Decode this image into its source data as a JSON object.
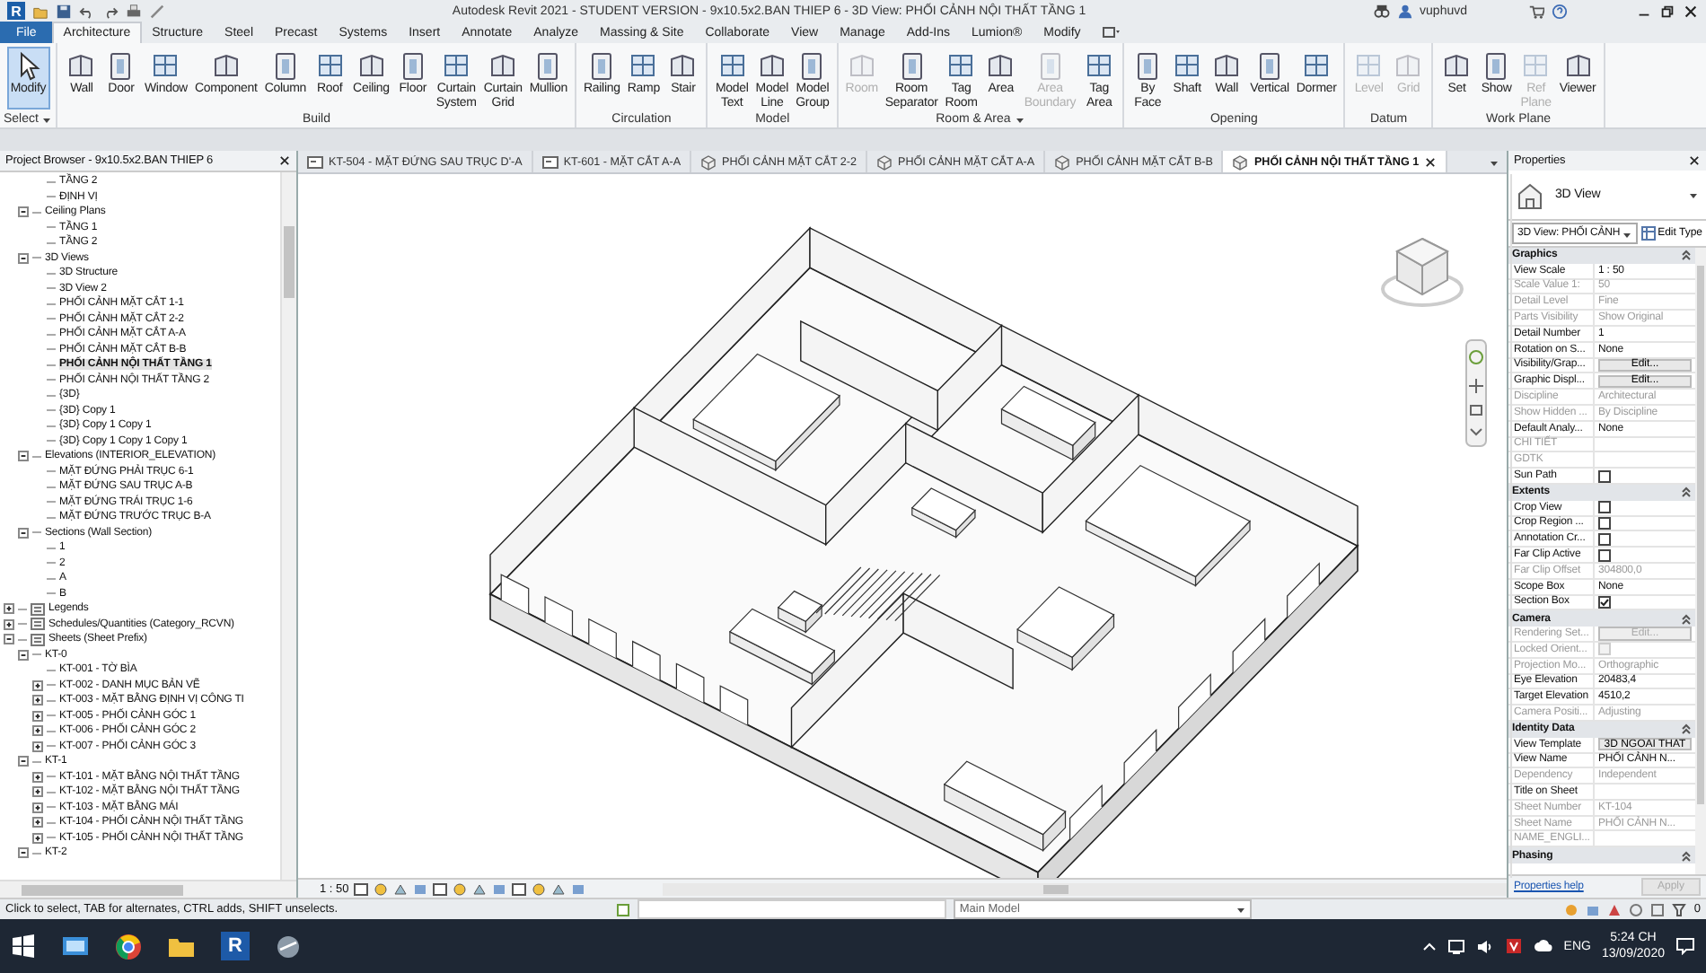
{
  "title_bar": {
    "app_logo": "R",
    "title": "Autodesk Revit 2021 - STUDENT VERSION - 9x10.5x2.BAN THIEP 6 - 3D View: PHỐI CẢNH NỘI THẤT TẦNG 1",
    "user": "vuphuvd"
  },
  "ribbon": {
    "file_tab": "File",
    "tabs": [
      {
        "label": "Architecture",
        "selected": true
      },
      {
        "label": "Structure",
        "selected": false
      },
      {
        "label": "Steel",
        "selected": false
      },
      {
        "label": "Precast",
        "selected": false
      },
      {
        "label": "Systems",
        "selected": false
      },
      {
        "label": "Insert",
        "selected": false
      },
      {
        "label": "Annotate",
        "selected": false
      },
      {
        "label": "Analyze",
        "selected": false
      },
      {
        "label": "Massing & Site",
        "selected": false
      },
      {
        "label": "Collaborate",
        "selected": false
      },
      {
        "label": "View",
        "selected": false
      },
      {
        "label": "Manage",
        "selected": false
      },
      {
        "label": "Add-Ins",
        "selected": false
      },
      {
        "label": "Lumion®",
        "selected": false
      },
      {
        "label": "Modify",
        "selected": false
      }
    ],
    "panels": [
      {
        "title": "Select",
        "menu": true,
        "tools": [
          {
            "label": "Modify",
            "active": true,
            "disabled": false
          }
        ]
      },
      {
        "title": "Build",
        "menu": false,
        "tools": [
          {
            "label": "Wall",
            "active": false,
            "disabled": false
          },
          {
            "label": "Door",
            "active": false,
            "disabled": false
          },
          {
            "label": "Window",
            "active": false,
            "disabled": false
          },
          {
            "label": "Component",
            "active": false,
            "disabled": false
          },
          {
            "label": "Column",
            "active": false,
            "disabled": false
          },
          {
            "label": "Roof",
            "active": false,
            "disabled": false
          },
          {
            "label": "Ceiling",
            "active": false,
            "disabled": false
          },
          {
            "label": "Floor",
            "active": false,
            "disabled": false
          },
          {
            "label": "Curtain System",
            "active": false,
            "disabled": false
          },
          {
            "label": "Curtain Grid",
            "active": false,
            "disabled": false
          },
          {
            "label": "Mullion",
            "active": false,
            "disabled": false
          }
        ]
      },
      {
        "title": "Circulation",
        "menu": false,
        "tools": [
          {
            "label": "Railing",
            "active": false,
            "disabled": false
          },
          {
            "label": "Ramp",
            "active": false,
            "disabled": false
          },
          {
            "label": "Stair",
            "active": false,
            "disabled": false
          }
        ]
      },
      {
        "title": "Model",
        "menu": false,
        "tools": [
          {
            "label": "Model Text",
            "active": false,
            "disabled": false
          },
          {
            "label": "Model Line",
            "active": false,
            "disabled": false
          },
          {
            "label": "Model Group",
            "active": false,
            "disabled": false
          }
        ]
      },
      {
        "title": "Room & Area",
        "menu": true,
        "tools": [
          {
            "label": "Room",
            "active": false,
            "disabled": true
          },
          {
            "label": "Room Separator",
            "active": false,
            "disabled": false
          },
          {
            "label": "Tag Room",
            "active": false,
            "disabled": false
          },
          {
            "label": "Area",
            "active": false,
            "disabled": false
          },
          {
            "label": "Area Boundary",
            "active": false,
            "disabled": true
          },
          {
            "label": "Tag Area",
            "active": false,
            "disabled": false
          }
        ]
      },
      {
        "title": "Opening",
        "menu": false,
        "tools": [
          {
            "label": "By Face",
            "active": false,
            "disabled": false
          },
          {
            "label": "Shaft",
            "active": false,
            "disabled": false
          },
          {
            "label": "Wall",
            "active": false,
            "disabled": false
          },
          {
            "label": "Vertical",
            "active": false,
            "disabled": false
          },
          {
            "label": "Dormer",
            "active": false,
            "disabled": false
          }
        ]
      },
      {
        "title": "Datum",
        "menu": false,
        "tools": [
          {
            "label": "Level",
            "active": false,
            "disabled": true
          },
          {
            "label": "Grid",
            "active": false,
            "disabled": true
          }
        ]
      },
      {
        "title": "Work Plane",
        "menu": false,
        "tools": [
          {
            "label": "Set",
            "active": false,
            "disabled": false
          },
          {
            "label": "Show",
            "active": false,
            "disabled": false
          },
          {
            "label": "Ref Plane",
            "active": false,
            "disabled": true
          },
          {
            "label": "Viewer",
            "active": false,
            "disabled": false
          }
        ]
      }
    ]
  },
  "browser": {
    "title": "Project Browser - 9x10.5x2.BAN THIEP 6",
    "tree": [
      {
        "children": [
          {
            "children": [
              {
                "label": "TẦNG 2",
                "selected": false
              },
              {
                "label": "ĐỊNH VỊ",
                "selected": false
              }
            ]
          },
          {
            "label": "Ceiling Plans",
            "selected": false,
            "expanded": true,
            "children": [
              {
                "label": "TẦNG 1",
                "selected": false
              },
              {
                "label": "TẦNG 2",
                "selected": false
              }
            ]
          },
          {
            "label": "3D Views",
            "selected": false,
            "expanded": true,
            "children": [
              {
                "label": "3D Structure",
                "selected": false
              },
              {
                "label": "3D View 2",
                "selected": false
              },
              {
                "label": "PHỐI CẢNH MẶT CẮT 1-1",
                "selected": false
              },
              {
                "label": "PHỐI CẢNH MẶT CẮT 2-2",
                "selected": false
              },
              {
                "label": "PHỐI CẢNH MẶT CẮT A-A",
                "selected": false
              },
              {
                "label": "PHỐI CẢNH MẶT CẮT B-B",
                "selected": false
              },
              {
                "label": "PHỐI CẢNH NỘI THẤT TẦNG 1",
                "selected": true
              },
              {
                "label": "PHỐI CẢNH NỘI THẤT TẦNG  2",
                "selected": false
              },
              {
                "label": "{3D}",
                "selected": false
              },
              {
                "label": "{3D} Copy 1",
                "selected": false
              },
              {
                "label": "{3D} Copy 1 Copy 1",
                "selected": false
              },
              {
                "label": "{3D} Copy 1 Copy 1 Copy 1",
                "selected": false
              }
            ]
          },
          {
            "label": "Elevations (INTERIOR_ELEVATION)",
            "selected": false,
            "expanded": true,
            "children": [
              {
                "label": "MẶT ĐỨNG PHẢI TRỤC 6-1",
                "selected": false
              },
              {
                "label": "MẶT ĐỨNG SAU TRỤC A-B",
                "selected": false
              },
              {
                "label": "MẶT ĐỨNG TRÁI TRỤC 1-6",
                "selected": false
              },
              {
                "label": "MẶT ĐỨNG TRƯỚC TRỤC B-A",
                "selected": false
              }
            ]
          },
          {
            "label": "Sections (Wall Section)",
            "selected": false,
            "expanded": true,
            "children": [
              {
                "label": "1",
                "selected": false
              },
              {
                "label": "2",
                "selected": false
              },
              {
                "label": "A",
                "selected": false
              },
              {
                "label": "B",
                "selected": false
              }
            ]
          }
        ]
      },
      {
        "label": "Legends",
        "selected": false,
        "expanded": false
      },
      {
        "label": "Schedules/Quantities (Category_RCVN)",
        "selected": false,
        "expanded": false
      },
      {
        "label": "Sheets (Sheet Prefix)",
        "selected": false,
        "expanded": true,
        "children": [
          {
            "label": "KT-0",
            "selected": false,
            "expanded": true,
            "children": [
              {
                "label": "KT-001 - TỜ BÌA",
                "selected": false
              },
              {
                "label": "KT-002 - DANH MỤC BẢN VẼ",
                "selected": false,
                "expanded": false
              },
              {
                "label": "KT-003 - MẶT BẰNG ĐỊNH VỊ CÔNG TI",
                "selected": false,
                "expanded": false
              },
              {
                "label": "KT-005 - PHỐI CẢNH GÓC 1",
                "selected": false,
                "expanded": false
              },
              {
                "label": "KT-006 - PHỐI CẢNH GÓC 2",
                "selected": false,
                "expanded": false
              },
              {
                "label": "KT-007 - PHỐI CẢNH GÓC 3",
                "selected": false,
                "expanded": false
              }
            ]
          },
          {
            "label": "KT-1",
            "selected": false,
            "expanded": true,
            "children": [
              {
                "label": "KT-101 - MẶT BẰNG NỘI THẤT TẦNG",
                "selected": false,
                "expanded": false
              },
              {
                "label": "KT-102 - MẶT BẰNG NỘI THẤT TẦNG",
                "selected": false,
                "expanded": false
              },
              {
                "label": "KT-103 - MẶT BẰNG MÁI",
                "selected": false,
                "expanded": false
              },
              {
                "label": "KT-104 - PHỐI CẢNH NỘI THẤT TẦNG",
                "selected": false,
                "expanded": false
              },
              {
                "label": "KT-105 - PHỐI CẢNH NỘI THẤT TẦNG",
                "selected": false,
                "expanded": false
              }
            ]
          },
          {
            "label": "KT-2",
            "selected": false,
            "expanded": true
          }
        ]
      }
    ]
  },
  "view_tabs": [
    {
      "label": "KT-504 - MẶT ĐỨNG SAU TRỤC D'-A",
      "kind": "sheet",
      "selected": false
    },
    {
      "label": "KT-601 - MẶT CẮT A-A",
      "kind": "sheet",
      "selected": false
    },
    {
      "label": "PHỐI CẢNH MẶT CẮT 2-2",
      "kind": "view",
      "selected": false
    },
    {
      "label": "PHỐI CẢNH MẶT CẮT A-A",
      "kind": "view",
      "selected": false
    },
    {
      "label": "PHỐI CẢNH MẶT CẮT B-B",
      "kind": "view",
      "selected": false
    },
    {
      "label": "PHỐI CẢNH NỘI THẤT TẦNG 1",
      "kind": "view",
      "selected": true
    }
  ],
  "view_bar": {
    "scale": "1 : 50"
  },
  "properties": {
    "title": "Properties",
    "type_name": "3D View",
    "selector": "3D View: PHỐI CẢNH",
    "edit_type": "Edit Type",
    "sections": [
      {
        "title": "Graphics",
        "expanded": true,
        "rows": [
          {
            "name": "View Scale",
            "value": "1 : 50",
            "kind": "text",
            "disabled": false
          },
          {
            "name": "Scale Value 1:",
            "value": "50",
            "kind": "text",
            "disabled": true
          },
          {
            "name": "Detail Level",
            "value": "Fine",
            "kind": "text",
            "disabled": true
          },
          {
            "name": "Parts Visibility",
            "value": "Show Original",
            "kind": "text",
            "disabled": true
          },
          {
            "name": "Detail Number",
            "value": "1",
            "kind": "text",
            "disabled": false
          },
          {
            "name": "Rotation on S...",
            "value": "None",
            "kind": "text",
            "disabled": false
          },
          {
            "name": "Visibility/Grap...",
            "value": "Edit...",
            "kind": "button",
            "disabled": false
          },
          {
            "name": "Graphic Displ...",
            "value": "Edit...",
            "kind": "button",
            "disabled": false
          },
          {
            "name": "Discipline",
            "value": "Architectural",
            "kind": "text",
            "disabled": true
          },
          {
            "name": "Show Hidden ...",
            "value": "By Discipline",
            "kind": "text",
            "disabled": true
          },
          {
            "name": "Default Analy...",
            "value": "None",
            "kind": "text",
            "disabled": false
          },
          {
            "name": "CHI TIẾT",
            "kind": "text",
            "disabled": true
          },
          {
            "name": "GDTK",
            "kind": "text",
            "disabled": true
          },
          {
            "name": "Sun Path",
            "kind": "check",
            "checked": false,
            "disabled": false
          }
        ]
      },
      {
        "title": "Extents",
        "expanded": true,
        "rows": [
          {
            "name": "Crop View",
            "kind": "check",
            "checked": false,
            "disabled": false
          },
          {
            "name": "Crop Region ...",
            "kind": "check",
            "checked": false,
            "disabled": false
          },
          {
            "name": "Annotation Cr...",
            "kind": "check",
            "checked": false,
            "disabled": false
          },
          {
            "name": "Far Clip Active",
            "kind": "check",
            "checked": false,
            "disabled": false
          },
          {
            "name": "Far Clip Offset",
            "value": "304800,0",
            "kind": "text",
            "disabled": true
          },
          {
            "name": "Scope Box",
            "value": "None",
            "kind": "text",
            "disabled": false
          },
          {
            "name": "Section Box",
            "kind": "check",
            "checked": true,
            "disabled": false
          }
        ]
      },
      {
        "title": "Camera",
        "expanded": true,
        "rows": [
          {
            "name": "Rendering Set...",
            "value": "Edit...",
            "kind": "button",
            "disabled": true
          },
          {
            "name": "Locked Orient...",
            "kind": "check",
            "checked": false,
            "disabled": true
          },
          {
            "name": "Projection Mo...",
            "value": "Orthographic",
            "kind": "text",
            "disabled": true
          },
          {
            "name": "Eye Elevation",
            "value": "20483,4",
            "kind": "text",
            "disabled": false
          },
          {
            "name": "Target Elevation",
            "value": "4510,2",
            "kind": "text",
            "disabled": false
          },
          {
            "name": "Camera Positi...",
            "value": "Adjusting",
            "kind": "text",
            "disabled": true
          }
        ]
      },
      {
        "title": "Identity Data",
        "expanded": true,
        "rows": [
          {
            "name": "View Template",
            "value": "3D NGOAI THAT",
            "kind": "button",
            "disabled": false
          },
          {
            "name": "View Name",
            "value": "PHỐI CẢNH N...",
            "kind": "text",
            "disabled": false
          },
          {
            "name": "Dependency",
            "value": "Independent",
            "kind": "text",
            "disabled": true
          },
          {
            "name": "Title on Sheet",
            "kind": "text",
            "disabled": false
          },
          {
            "name": "Sheet Number",
            "value": "KT-104",
            "kind": "text",
            "disabled": true
          },
          {
            "name": "Sheet Name",
            "value": "PHỐI CẢNH N...",
            "kind": "text",
            "disabled": true
          },
          {
            "name": "NAME_ENGLI...",
            "kind": "text",
            "disabled": true
          }
        ]
      },
      {
        "title": "Phasing",
        "expanded": true
      }
    ],
    "help": "Properties help",
    "apply": {
      "label": "Apply",
      "disabled": true
    }
  },
  "status_bar": {
    "hint": "Click to select, TAB for alternates, CTRL adds, SHIFT unselects.",
    "workset": "Main Model",
    "selection_count": "0"
  },
  "taskbar": {
    "revit_label": "R",
    "language": "ENG",
    "time": "5:24 CH",
    "date": "13/09/2020"
  }
}
